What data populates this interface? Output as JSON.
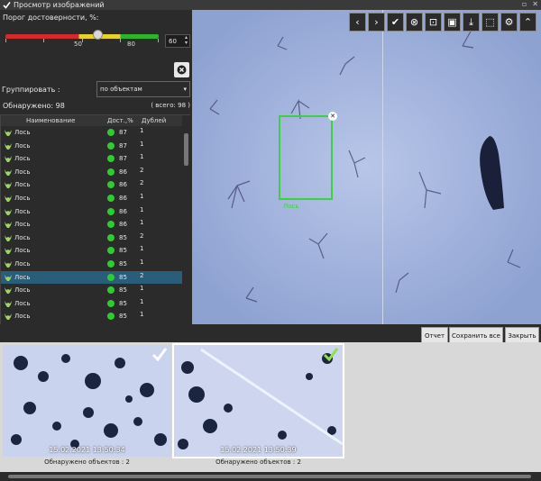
{
  "window": {
    "title": "Просмотр изображений",
    "controls": [
      "▫",
      "✕"
    ]
  },
  "threshold": {
    "label": "Порог достоверности, %:",
    "value": "60",
    "slider_level_percent": 60,
    "tick_labels": [
      "50",
      "80"
    ]
  },
  "group": {
    "label": "Группировать :",
    "selected": "по объектам"
  },
  "summary": {
    "found": "Обнаружено: 98",
    "total": "( всего: 98 )"
  },
  "table": {
    "columns": [
      "Наименование",
      "Дост.,%",
      "Дублей"
    ],
    "rows": [
      {
        "name": "Лось",
        "conf": "87",
        "dup": "1",
        "selected": false
      },
      {
        "name": "Лось",
        "conf": "87",
        "dup": "1",
        "selected": false
      },
      {
        "name": "Лось",
        "conf": "87",
        "dup": "1",
        "selected": false
      },
      {
        "name": "Лось",
        "conf": "86",
        "dup": "2",
        "selected": false
      },
      {
        "name": "Лось",
        "conf": "86",
        "dup": "2",
        "selected": false
      },
      {
        "name": "Лось",
        "conf": "86",
        "dup": "1",
        "selected": false
      },
      {
        "name": "Лось",
        "conf": "86",
        "dup": "1",
        "selected": false
      },
      {
        "name": "Лось",
        "conf": "86",
        "dup": "1",
        "selected": false
      },
      {
        "name": "Лось",
        "conf": "85",
        "dup": "2",
        "selected": false
      },
      {
        "name": "Лось",
        "conf": "85",
        "dup": "1",
        "selected": false
      },
      {
        "name": "Лось",
        "conf": "85",
        "dup": "1",
        "selected": false
      },
      {
        "name": "Лось",
        "conf": "85",
        "dup": "2",
        "selected": true
      },
      {
        "name": "Лось",
        "conf": "85",
        "dup": "1",
        "selected": false
      },
      {
        "name": "Лось",
        "conf": "85",
        "dup": "1",
        "selected": false
      },
      {
        "name": "Лось",
        "conf": "85",
        "dup": "1",
        "selected": false
      }
    ]
  },
  "viewer": {
    "toolbar_icons": [
      "chevron-left-icon",
      "chevron-right-icon",
      "check-icon",
      "close-circle-icon",
      "fit-icon",
      "save-icon",
      "download-icon",
      "select-icon",
      "gear-icon",
      "chevron-up-icon"
    ],
    "detection_label": "Лось"
  },
  "actions": {
    "report": "Отчет",
    "save_all": "Сохранить все",
    "close": "Закрыть"
  },
  "thumbnails": [
    {
      "timestamp": "15.02.2021 13:50:34",
      "caption": "Обнаружено объектов : 2",
      "check_color": "#ffffff",
      "selected": false
    },
    {
      "timestamp": "15.02.2021 13:50:39",
      "caption": "Обнаружено объектов : 2",
      "check_color": "#8fe04a",
      "selected": true
    }
  ],
  "colors": {
    "accent_green": "#3dd13d",
    "selection": "#2a5d7a"
  }
}
